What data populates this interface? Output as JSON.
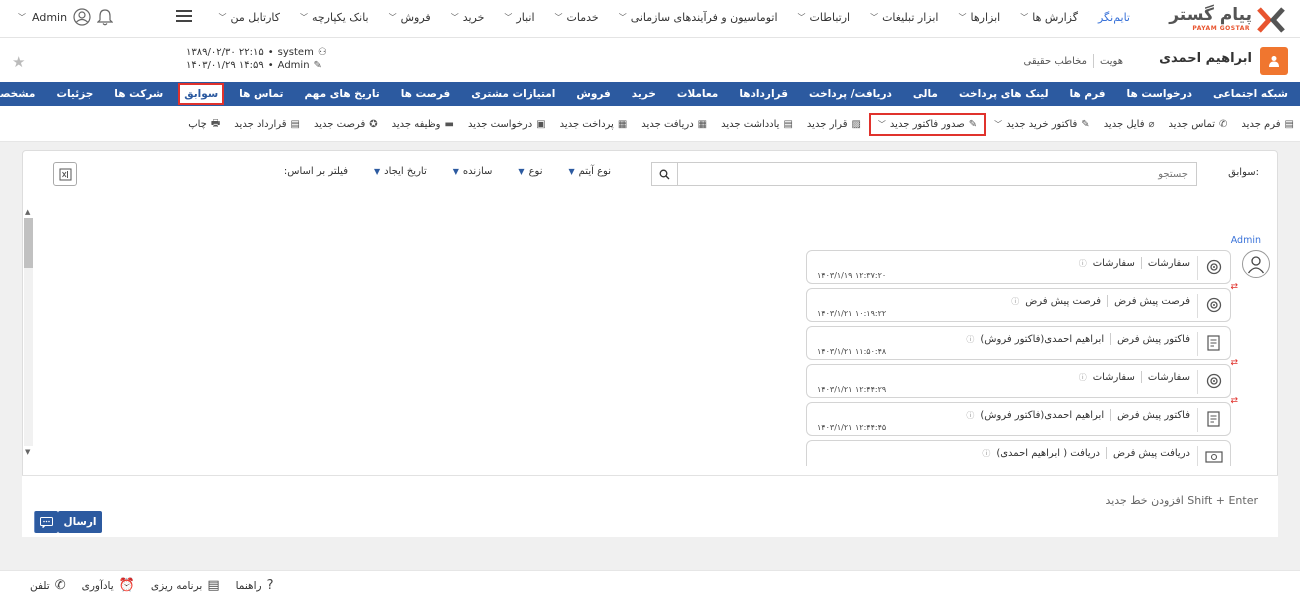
{
  "brand": {
    "name_fa": "پیام گستر",
    "name_en": "PAYAM GOSTAR",
    "accent": "#e8542f"
  },
  "topnav": {
    "items": [
      {
        "label": "کارتابل من",
        "chev": true
      },
      {
        "label": "بانک یکپارچه",
        "chev": true
      },
      {
        "label": "فروش",
        "chev": true
      },
      {
        "label": "خرید",
        "chev": true
      },
      {
        "label": "انبار",
        "chev": true
      },
      {
        "label": "خدمات",
        "chev": true
      },
      {
        "label": "اتوماسیون و فرآیندهای سازمانی",
        "chev": true
      },
      {
        "label": "ارتباطات",
        "chev": true
      },
      {
        "label": "ابزار تبلیغات",
        "chev": true
      },
      {
        "label": "ابزارها",
        "chev": true
      },
      {
        "label": "گزارش ها",
        "chev": true
      },
      {
        "label": "تایم‌نگر",
        "chev": false,
        "active": true
      }
    ]
  },
  "user": {
    "name": "Admin"
  },
  "person": {
    "name": "ابراهیم احمدی",
    "type": "هویت",
    "kind": "مخاطب حقیقی"
  },
  "sysinfo": {
    "created_by": "system",
    "created_at": "۱۳۸۹/۰۲/۳۰ ۲۲:۱۵",
    "modified_by": "Admin",
    "modified_at": "۱۴۰۳/۰۱/۲۹ ۱۴:۵۹"
  },
  "tabs": {
    "items": [
      {
        "label": "مشخصات"
      },
      {
        "label": "جزئیات"
      },
      {
        "label": "شرکت ها"
      },
      {
        "label": "سوابق",
        "selected": true
      },
      {
        "label": "تماس ها"
      },
      {
        "label": "تاریخ های مهم"
      },
      {
        "label": "فرصت ها"
      },
      {
        "label": "امتیازات مشتری"
      },
      {
        "label": "فروش"
      },
      {
        "label": "خرید"
      },
      {
        "label": "معاملات"
      },
      {
        "label": "قراردادها"
      },
      {
        "label": "دریافت/ پرداخت"
      },
      {
        "label": "مالی"
      },
      {
        "label": "لینک های پرداخت"
      },
      {
        "label": "فرم ها"
      },
      {
        "label": "درخواست ها"
      },
      {
        "label": "شبکه اجتماعی"
      }
    ]
  },
  "actions": {
    "items": [
      {
        "label": "چاپ",
        "icon": "print-icon",
        "glyph": "🖶"
      },
      {
        "label": "قرارداد جدید",
        "icon": "contract-icon",
        "glyph": "▤"
      },
      {
        "label": "فرصت جدید",
        "icon": "opportunity-icon",
        "glyph": "✪"
      },
      {
        "label": "وظیفه جدید",
        "icon": "task-icon",
        "glyph": "▬"
      },
      {
        "label": "درخواست جدید",
        "icon": "request-icon",
        "glyph": "▣"
      },
      {
        "label": "پرداخت جدید",
        "icon": "payment-icon",
        "glyph": "▦"
      },
      {
        "label": "دریافت جدید",
        "icon": "receipt-icon",
        "glyph": "▦"
      },
      {
        "label": "یادداشت جدید",
        "icon": "note-icon",
        "glyph": "▤"
      },
      {
        "label": "قرار جدید",
        "icon": "appointment-icon",
        "glyph": "▨"
      },
      {
        "label": "صدور فاکتور جدید",
        "icon": "invoice-icon",
        "glyph": "✎",
        "dropdown": true,
        "highlight": true
      },
      {
        "label": "فاکتور خرید جدید",
        "icon": "purchase-invoice-icon",
        "glyph": "✎",
        "dropdown": true
      },
      {
        "label": "فایل جدید",
        "icon": "attach-icon",
        "glyph": "⌀"
      },
      {
        "label": "تماس جدید",
        "icon": "phone-icon",
        "glyph": "✆"
      },
      {
        "label": "فرم جدید",
        "icon": "form-icon",
        "glyph": "▤"
      }
    ]
  },
  "history": {
    "label": "سوابق:",
    "search_placeholder": "جستجو",
    "filter_label": "فیلتر بر اساس:",
    "filters": [
      {
        "label": "تاریخ ایجاد"
      },
      {
        "label": "سازنده"
      },
      {
        "label": "نوع"
      },
      {
        "label": "نوع آیتم"
      }
    ],
    "author": "Admin",
    "entries": [
      {
        "type": "سفارشات",
        "title": "سفارشات",
        "date": "۱۴۰۳/۱/۱۹ ۱۲:۳۷:۲۰",
        "icon": "order-icon",
        "badge": false
      },
      {
        "type": "فرصت پیش فرض",
        "title": "فرصت پیش فرض",
        "date": "۱۴۰۳/۱/۲۱ ۱۰:۱۹:۲۲",
        "icon": "opportunity-icon",
        "badge": true
      },
      {
        "type": "فاکتور پیش فرض",
        "title": "ابراهیم احمدی(فاکتور فروش)",
        "date": "۱۴۰۳/۱/۲۱ ۱۱:۵۰:۴۸",
        "icon": "invoice-icon",
        "badge": false
      },
      {
        "type": "سفارشات",
        "title": "سفارشات",
        "date": "۱۴۰۳/۱/۲۱ ۱۲:۴۴:۲۹",
        "icon": "order-icon",
        "badge": true
      },
      {
        "type": "فاکتور پیش فرض",
        "title": "ابراهیم احمدی(فاکتور فروش)",
        "date": "۱۴۰۳/۱/۲۱ ۱۲:۴۴:۴۵",
        "icon": "invoice-icon",
        "badge": true
      },
      {
        "type": "دریافت پیش فرض",
        "title": "دریافت ( ابراهیم احمدی)",
        "date": "",
        "icon": "money-icon",
        "badge": false
      }
    ]
  },
  "composer": {
    "placeholder": "Shift + Enter افزودن خط جدید",
    "send_label": "ارسال"
  },
  "footer": {
    "items": [
      {
        "label": "تلفن",
        "icon": "phone-icon",
        "glyph": "✆"
      },
      {
        "label": "یادآوری",
        "icon": "alarm-icon",
        "glyph": "⏰"
      },
      {
        "label": "برنامه ریزی",
        "icon": "planner-icon",
        "glyph": "▤"
      },
      {
        "label": "راهنما",
        "icon": "help-icon",
        "glyph": "?"
      }
    ]
  }
}
